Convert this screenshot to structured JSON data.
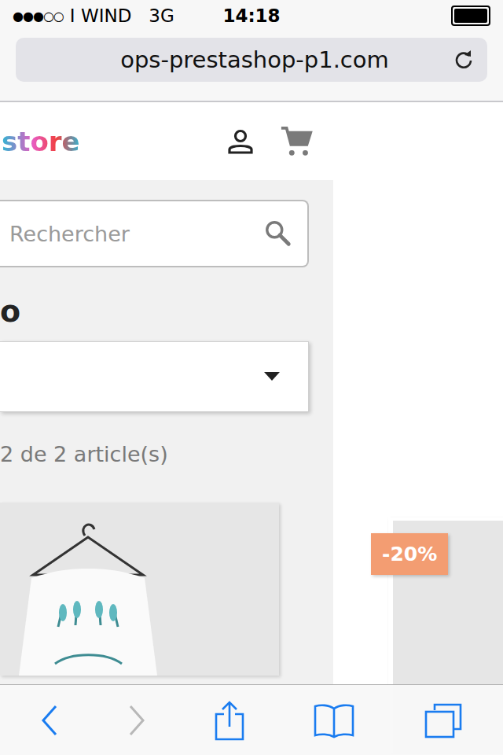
{
  "status_bar": {
    "signal": "●●●○○",
    "carrier": "I WIND",
    "network": "3G",
    "time": "14:18",
    "battery_level": 1
  },
  "address_bar": {
    "url": "ops-prestashop-p1.com"
  },
  "header": {
    "logo": "store"
  },
  "search": {
    "placeholder": "Rechercher"
  },
  "category": {
    "title": "o"
  },
  "product_count": "2 de 2 article(s)",
  "products": [
    {
      "discounted": false
    },
    {
      "discounted": true,
      "badge": "-20%"
    }
  ],
  "toolbar": [
    {
      "kind": "back",
      "disabled": false
    },
    {
      "kind": "forward",
      "disabled": true
    },
    {
      "kind": "share",
      "disabled": false
    },
    {
      "kind": "bookmarks",
      "disabled": false
    },
    {
      "kind": "tabs",
      "disabled": false
    }
  ]
}
